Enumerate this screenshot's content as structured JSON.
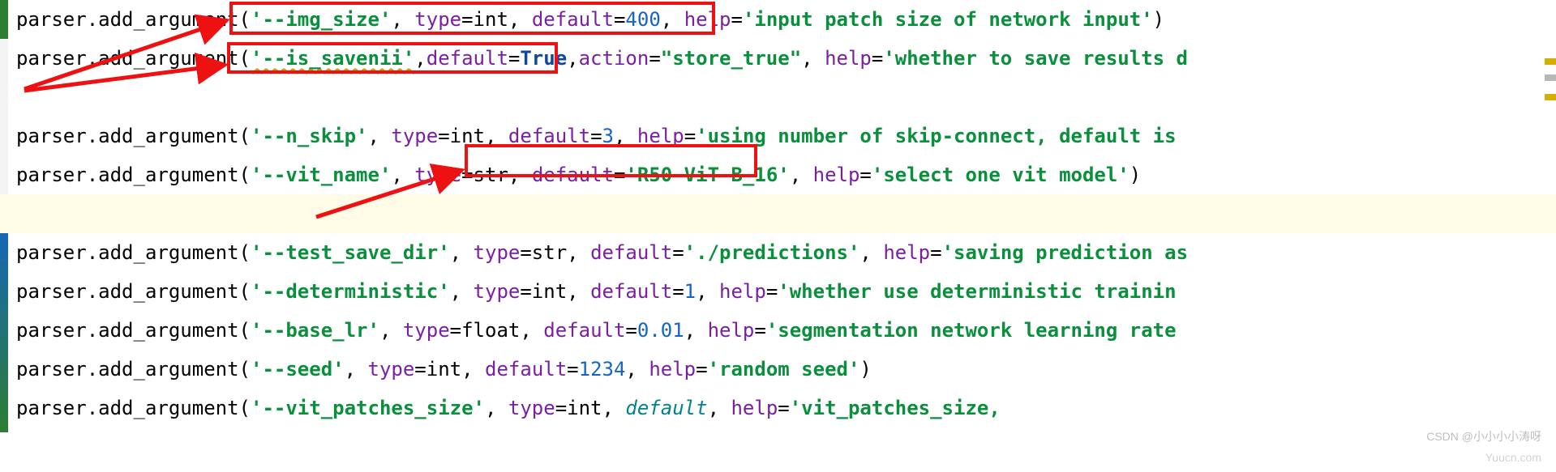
{
  "code": {
    "obj": "parser",
    "method": "add_argument",
    "kw_type": "type",
    "kw_default": "default",
    "kw_action": "action",
    "kw_help": "help",
    "ty_int": "int",
    "ty_str": "str",
    "ty_float": "float",
    "lines": {
      "l1": {
        "name": "'--img_size'",
        "deflt": "400",
        "help": "'input patch size of network input'"
      },
      "l2": {
        "name": "'--is_savenii'",
        "deflt": "True",
        "action": "\"store_true\"",
        "help": "'whether to save results d"
      },
      "l3": {
        "name": "'--n_skip'",
        "deflt": "3",
        "help": "'using number of skip-connect, default is"
      },
      "l4": {
        "name": "'--vit_name'",
        "deflt": "'R50-ViT-B_16'",
        "help": "'select one vit model'"
      },
      "l5": {
        "name": "'--test_save_dir'",
        "deflt": "'./predictions'",
        "help": "'saving prediction as"
      },
      "l6": {
        "name": "'--deterministic'",
        "deflt": "1",
        "help": "'whether use deterministic trainin"
      },
      "l7": {
        "name": "'--base_lr'",
        "deflt": "0.01",
        "help": "'segmentation network learning rate"
      },
      "l8": {
        "name": "'--seed'",
        "deflt": "1234",
        "help": "'random seed'"
      },
      "l9": {
        "name": "'--vit_patches_size'",
        "deflt_kw": "default",
        "help": "'vit_patches_size,"
      }
    }
  },
  "watermark": {
    "a": "CSDN @小小小小涛呀",
    "b": "Yuucn.com"
  }
}
